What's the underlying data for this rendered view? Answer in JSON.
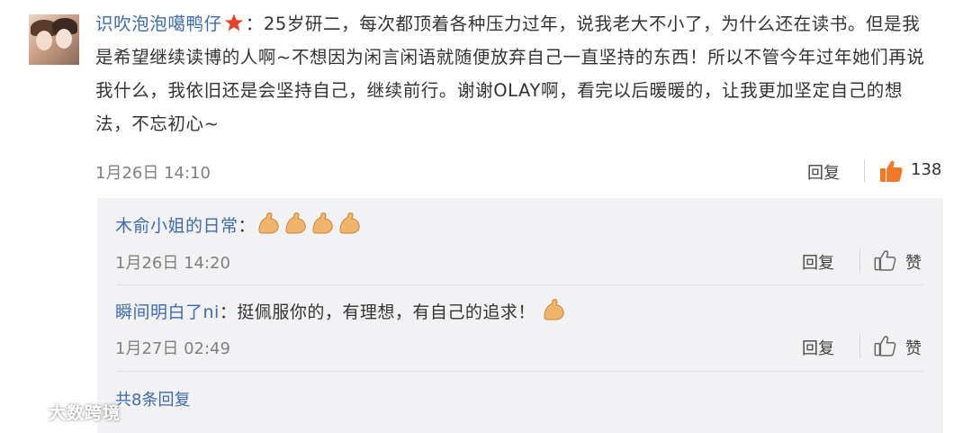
{
  "comment": {
    "username": "识吹泡泡噶鸭仔",
    "separator": "：",
    "text": "25岁研二，每次都顶着各种压力过年，说我老大不小了，为什么还在读书。但是我是希望继续读博的人啊~不想因为闲言闲语就随便放弃自己一直坚持的东西！所以不管今年过年她们再说我什么，我依旧还是会坚持自己，继续前行。谢谢OLAY啊，看完以后暖暖的，让我更加坚定自己的想法，不忘初心~",
    "timestamp": "1月26日 14:10",
    "reply_label": "回复",
    "like_count": "138"
  },
  "replies": [
    {
      "username": "木俞小姐的日常",
      "separator": "：",
      "text": "",
      "emoji": "flexed-biceps-emoji",
      "emoji_count": 4,
      "timestamp": "1月26日 14:20",
      "reply_label": "回复",
      "like_label": "赞"
    },
    {
      "username": "瞬间明白了ni",
      "separator": "：",
      "text": "挺佩服你的，有理想，有自己的追求！",
      "emoji": "flexed-biceps-emoji",
      "emoji_count": 1,
      "timestamp": "1月27日 02:49",
      "reply_label": "回复",
      "like_label": "赞"
    }
  ],
  "more_replies": "共8条回复",
  "watermark": "大数跨境",
  "colors": {
    "link": "#3b6bb2",
    "star": "#e8412c",
    "like_active": "#f07a2a",
    "reply_bg": "#f2f2f5",
    "meta": "#808080"
  }
}
